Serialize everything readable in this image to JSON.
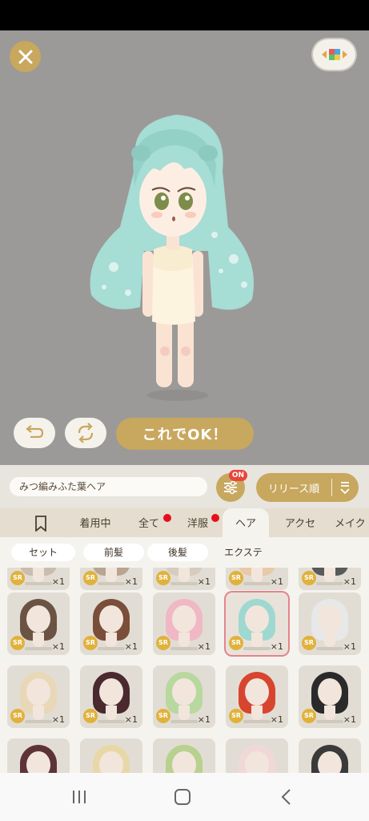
{
  "outfit_name": "みつ編みふた葉ヘア",
  "ok_button": "これでOK！",
  "filter_badge": "ON",
  "sort_label": "リリース順",
  "tabs": [
    {
      "label": "着用中"
    },
    {
      "label": "全て"
    },
    {
      "label": "洋服"
    },
    {
      "label": "ヘア"
    },
    {
      "label": "アクセ"
    },
    {
      "label": "メイク"
    }
  ],
  "subtabs": [
    {
      "label": "セット"
    },
    {
      "label": "前髪"
    },
    {
      "label": "後髪"
    },
    {
      "label": "エクステ"
    }
  ],
  "items": {
    "rarity": "SR",
    "quantity": "×1"
  },
  "colors": {
    "accent_gold": "#c8a75e",
    "stage_gray": "#9b9a98",
    "selected_border": "#e4848c",
    "notification_red": "#e3101c",
    "hair_mint": "#9fd8d0"
  },
  "selected_item": "row 2, column 4"
}
